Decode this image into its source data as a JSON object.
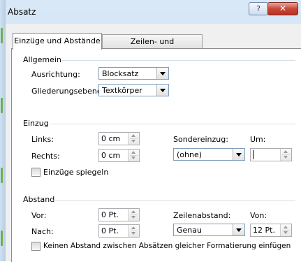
{
  "window": {
    "title": "Absatz",
    "help_label": "?",
    "close_label": "✕"
  },
  "tabs": [
    {
      "label": "Einzüge und Abstände",
      "active": true
    },
    {
      "label": "Zeilen- und Seitenumbruch",
      "active": false
    }
  ],
  "allgemein": {
    "heading": "Allgemein",
    "ausrichtung_label": "Ausrichtung:",
    "ausrichtung_value": "Blocksatz",
    "gliederung_label": "Gliederungsebene:",
    "gliederung_value": "Textkörper"
  },
  "einzug": {
    "heading": "Einzug",
    "links_label": "Links:",
    "links_value": "0 cm",
    "rechts_label": "Rechts:",
    "rechts_value": "0 cm",
    "sondereinzug_label": "Sondereinzug:",
    "sondereinzug_value": "(ohne)",
    "um_label": "Um:",
    "um_value": "",
    "spiegeln_label": "Einzüge spiegeln",
    "spiegeln_checked": false
  },
  "abstand": {
    "heading": "Abstand",
    "vor_label": "Vor:",
    "vor_value": "0 Pt.",
    "nach_label": "Nach:",
    "nach_value": "0 Pt.",
    "zeilenabstand_label": "Zeilenabstand:",
    "zeilenabstand_value": "Genau",
    "von_label": "Von:",
    "von_value": "12 Pt.",
    "keinen_abstand_label": "Keinen Abstand zwischen Absätzen gleicher Formatierung einfügen",
    "keinen_abstand_checked": false
  }
}
